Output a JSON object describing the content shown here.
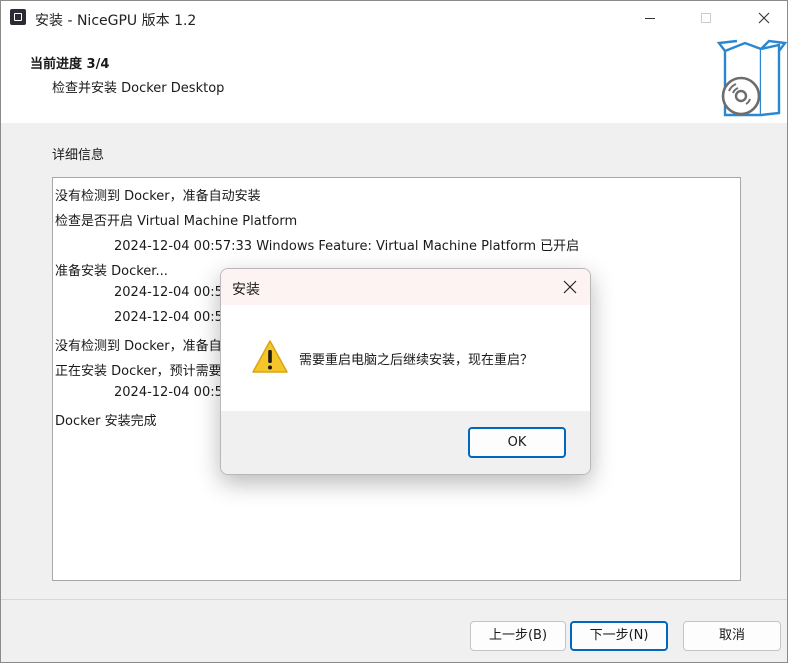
{
  "window": {
    "title": "安装 - NiceGPU 版本 1.2"
  },
  "header": {
    "step_title": "当前进度 3/4",
    "step_desc": "检查并安装 Docker Desktop",
    "icon": "install-box-disc-icon"
  },
  "details": {
    "label": "详细信息",
    "log": [
      "没有检测到 Docker，准备自动安装",
      "检查是否开启 Virtual Machine Platform",
      "2024-12-04 00:57:33  Windows Feature: Virtual Machine Platform 已开启",
      "准备安装 Docker...",
      "2024-12-04 00:5",
      "2024-12-04 00:5",
      "没有检测到 Docker，准备自",
      "正在安装 Docker，预计需要",
      "2024-12-04 00:5",
      "Docker 安装完成"
    ]
  },
  "buttons": {
    "back": "上一步(B)",
    "next": "下一步(N)",
    "cancel": "取消"
  },
  "dialog": {
    "title": "安装",
    "message": "需要重启电脑之后继续安装，现在重启？",
    "ok": "OK",
    "icon": "warning-icon"
  },
  "colors": {
    "accent": "#0067c0",
    "warning": "#f4c62a",
    "icon_blue": "#2b87d1"
  }
}
